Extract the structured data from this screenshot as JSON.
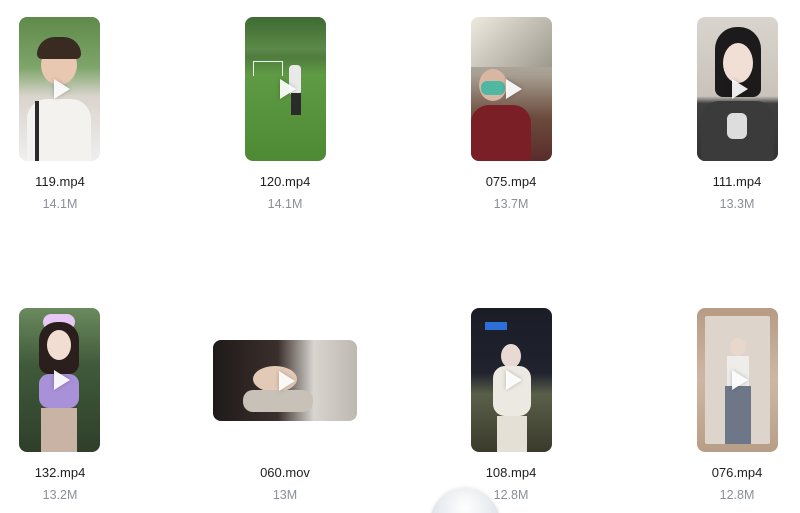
{
  "files": [
    {
      "name": "119.mp4",
      "size": "14.1M"
    },
    {
      "name": "120.mp4",
      "size": "14.1M"
    },
    {
      "name": "075.mp4",
      "size": "13.7M"
    },
    {
      "name": "111.mp4",
      "size": "13.3M"
    },
    {
      "name": "132.mp4",
      "size": "13.2M"
    },
    {
      "name": "060.mov",
      "size": "13M"
    },
    {
      "name": "108.mp4",
      "size": "12.8M"
    },
    {
      "name": "076.mp4",
      "size": "12.8M"
    }
  ],
  "icons": {
    "thumbnail_overlay": "play-icon"
  }
}
